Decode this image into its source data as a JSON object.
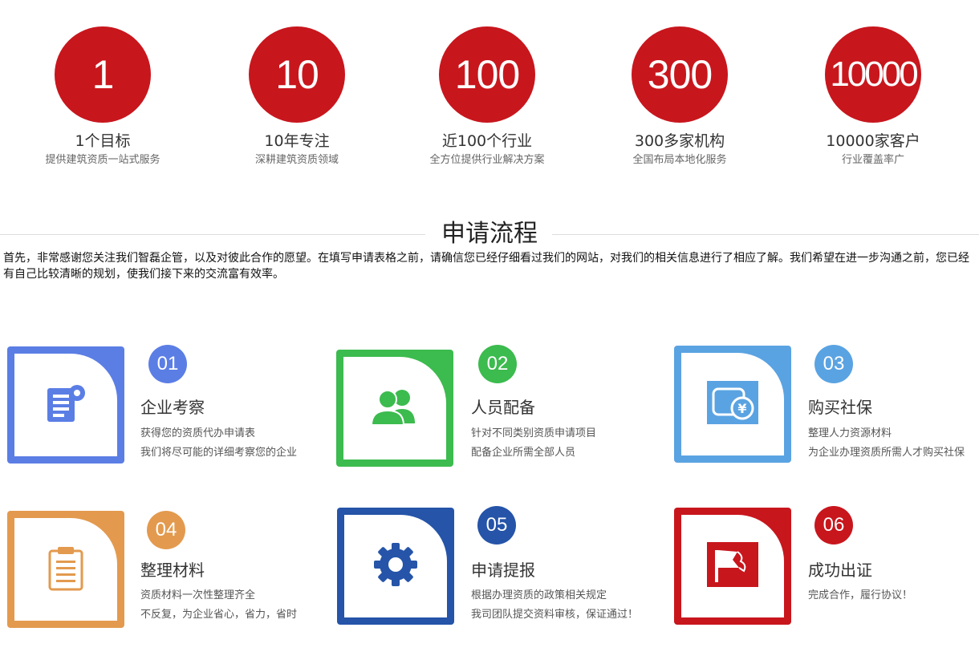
{
  "stats": [
    {
      "number": "1",
      "title": "1个目标",
      "subtitle": "提供建筑资质一站式服务"
    },
    {
      "number": "10",
      "title": "10年专注",
      "subtitle": "深耕建筑资质领域"
    },
    {
      "number": "100",
      "title": "近100个行业",
      "subtitle": "全方位提供行业解决方案"
    },
    {
      "number": "300",
      "title": "300多家机构",
      "subtitle": "全国布局本地化服务"
    },
    {
      "number": "10000",
      "title": "10000家客户",
      "subtitle": "行业覆盖率广"
    }
  ],
  "section": {
    "title": "申请流程",
    "intro": "首先，非常感谢您关注我们智磊企管，以及对彼此合作的愿望。在填写申请表格之前，请确信您已经仔细看过我们的网站，对我们的相关信息进行了相应了解。我们希望在进一步沟通之前，您已经有自己比较清晰的规划，使我们接下来的交流富有效率。"
  },
  "steps": [
    {
      "number": "01",
      "title": "企业考察",
      "line1": "获得您的资质代办申请表",
      "line2": "我们将尽可能的详细考察您的企业",
      "color": "#5b7ee5",
      "icon": "document-icon"
    },
    {
      "number": "02",
      "title": "人员配备",
      "line1": "针对不同类别资质申请项目",
      "line2": "配备企业所需全部人员",
      "color": "#3cbb4e",
      "icon": "users-icon"
    },
    {
      "number": "03",
      "title": "购买社保",
      "line1": "整理人力资源材料",
      "line2": "为企业办理资质所需人才购买社保",
      "color": "#5aa3e2",
      "icon": "yuan-card-icon"
    },
    {
      "number": "04",
      "title": "整理材料",
      "line1": "资质材料一次性整理齐全",
      "line2": "不反复，为企业省心，省力，省时",
      "color": "#e39a4e",
      "icon": "clipboard-icon"
    },
    {
      "number": "05",
      "title": "申请提报",
      "line1": "根据办理资质的政策相关规定",
      "line2": "我司团队提交资料审核，保证通过！",
      "color": "#2554a8",
      "icon": "gear-icon"
    },
    {
      "number": "06",
      "title": "成功出证",
      "line1": "完成合作，履行协议！",
      "line2": "",
      "color": "#c8161d",
      "icon": "flag-icon"
    }
  ]
}
